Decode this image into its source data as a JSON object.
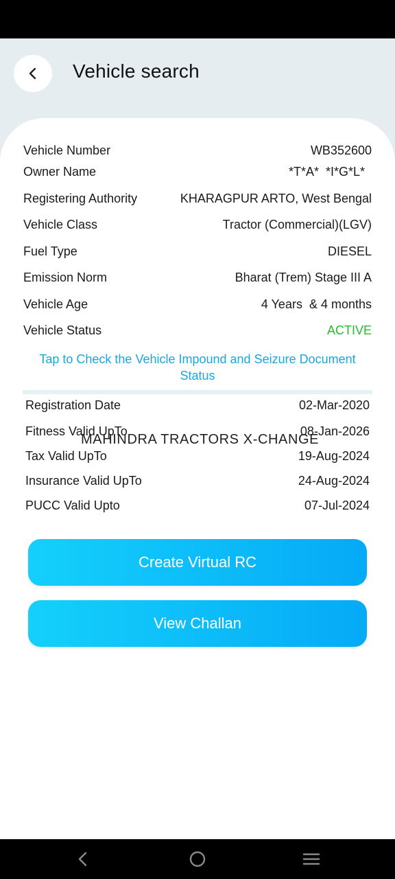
{
  "header": {
    "title": "Vehicle search"
  },
  "details": [
    {
      "label": "Vehicle Number",
      "value": "WB352600"
    },
    {
      "label": "Owner Name",
      "value": "*T*A*  *I*G*L*"
    },
    {
      "label": "Registering Authority",
      "value": "KHARAGPUR ARTO, West Bengal"
    },
    {
      "label": "Vehicle Class",
      "value": "Tractor (Commercial)(LGV)"
    },
    {
      "label": "Fuel Type",
      "value": "DIESEL"
    },
    {
      "label": "Emission Norm",
      "value": "Bharat (Trem) Stage III A"
    },
    {
      "label": "Vehicle Age",
      "value": "4 Years  & 4 months"
    },
    {
      "label": "Vehicle Status",
      "value": "ACTIVE"
    }
  ],
  "impound_link": "Tap to Check the Vehicle Impound and Seizure Document Status",
  "validity": [
    {
      "label": "Registration Date",
      "value": "02-Mar-2020"
    },
    {
      "label": "Fitness Valid UpTo",
      "value": "08-Jan-2026"
    },
    {
      "label": "Tax Valid UpTo",
      "value": "19-Aug-2024"
    },
    {
      "label": "Insurance Valid UpTo",
      "value": "24-Aug-2024"
    },
    {
      "label": "PUCC Valid Upto",
      "value": "07-Jul-2024"
    }
  ],
  "watermark": "MAHINDRA TRACTORS X-CHANGE",
  "buttons": {
    "create_rc": "Create Virtual RC",
    "view_challan": "View Challan"
  },
  "colors": {
    "accent": "#14d0fb",
    "status_active": "#21c02b",
    "link": "#18a7e0"
  },
  "icons": {
    "back": "chevron-left-icon",
    "nav_back": "nav-back-icon",
    "nav_home": "nav-home-icon",
    "nav_menu": "nav-menu-icon"
  }
}
